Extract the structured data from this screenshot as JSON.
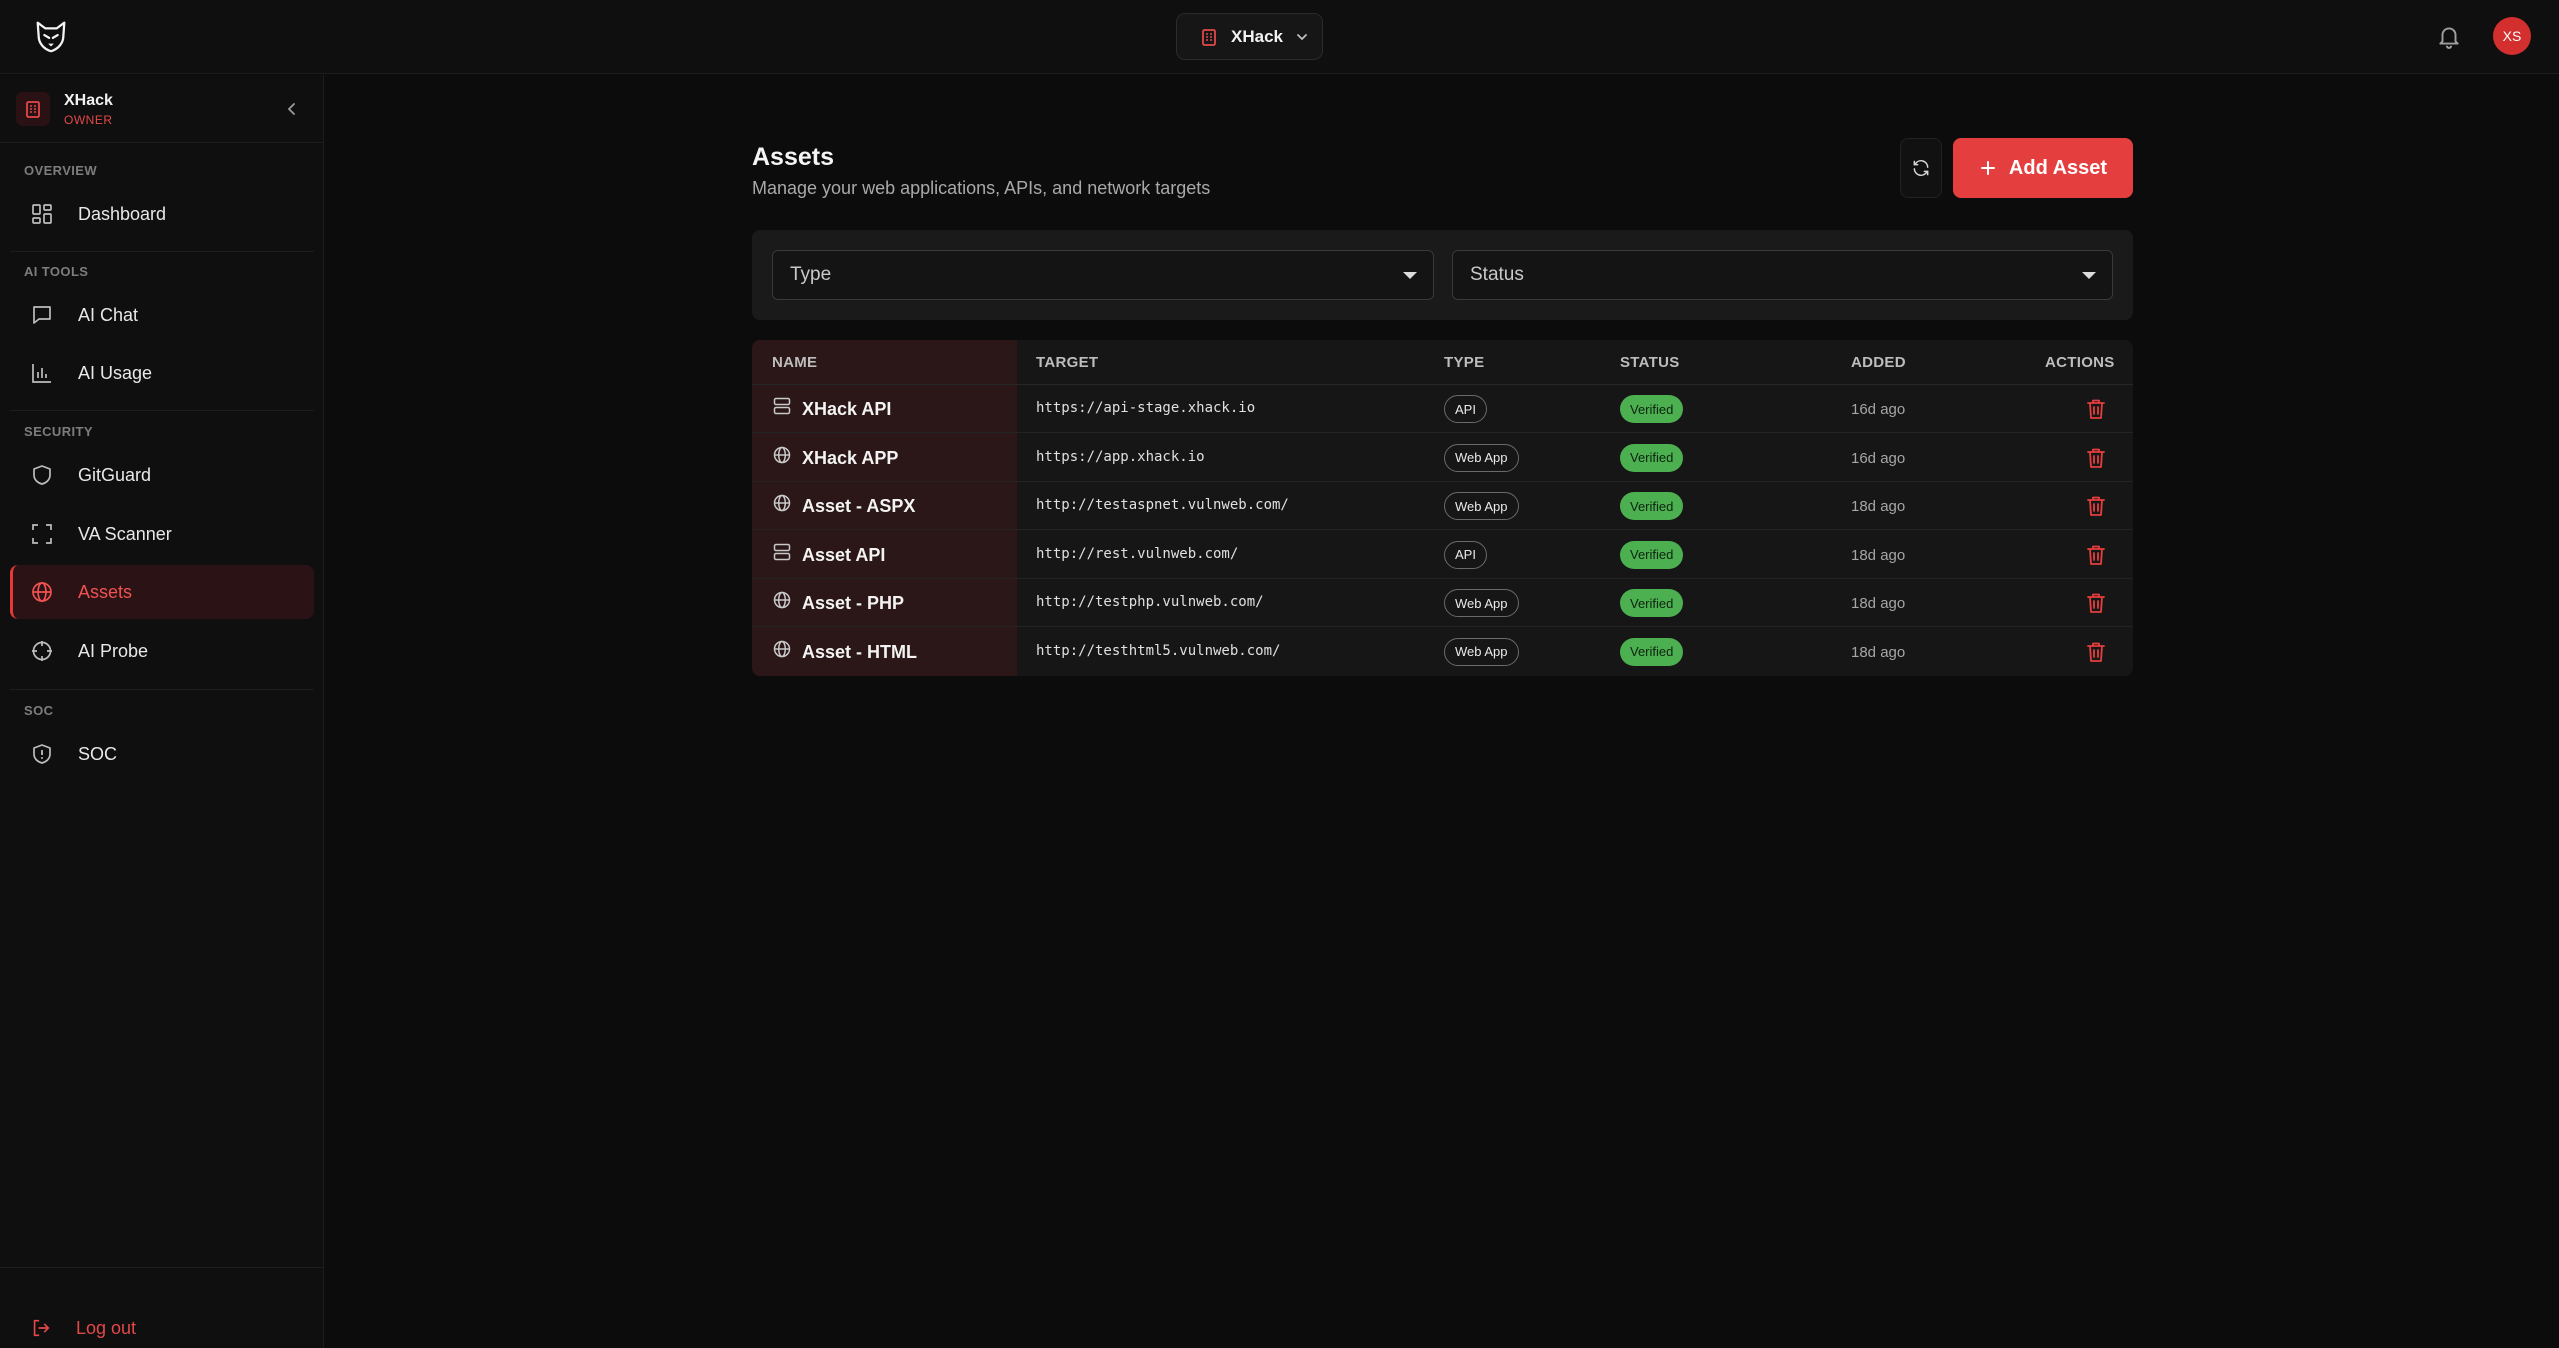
{
  "header": {
    "org_name": "XHack",
    "avatar_initials": "XS"
  },
  "sidebar": {
    "workspace": {
      "name": "XHack",
      "role": "OWNER"
    },
    "sections": [
      {
        "title": "OVERVIEW",
        "items": [
          {
            "label": "Dashboard",
            "icon": "dashboard-icon"
          }
        ]
      },
      {
        "title": "AI TOOLS",
        "items": [
          {
            "label": "AI Chat",
            "icon": "chat-icon"
          },
          {
            "label": "AI Usage",
            "icon": "bar-chart-icon"
          }
        ]
      },
      {
        "title": "SECURITY",
        "items": [
          {
            "label": "GitGuard",
            "icon": "shield-icon"
          },
          {
            "label": "VA Scanner",
            "icon": "scan-icon"
          },
          {
            "label": "Assets",
            "icon": "globe-icon",
            "active": true
          },
          {
            "label": "AI Probe",
            "icon": "crosshair-icon"
          }
        ]
      },
      {
        "title": "SOC",
        "items": [
          {
            "label": "SOC",
            "icon": "shield-alert-icon"
          }
        ]
      }
    ],
    "logout_label": "Log out"
  },
  "main": {
    "title": "Assets",
    "subtitle": "Manage your web applications, APIs, and network targets",
    "add_button_label": "Add Asset",
    "filters": {
      "type_placeholder": "Type",
      "status_placeholder": "Status"
    },
    "columns": {
      "name": "NAME",
      "target": "TARGET",
      "type": "TYPE",
      "status": "STATUS",
      "added": "ADDED",
      "actions": "ACTIONS"
    },
    "rows": [
      {
        "name": "XHack API",
        "icon": "server-icon",
        "target": "https://api-stage.xhack.io",
        "type": "API",
        "status": "Verified",
        "added": "16d ago"
      },
      {
        "name": "XHack APP",
        "icon": "globe-icon",
        "target": "https://app.xhack.io",
        "type": "Web App",
        "status": "Verified",
        "added": "16d ago"
      },
      {
        "name": "Asset - ASPX",
        "icon": "globe-icon",
        "target": "http://testaspnet.vulnweb.com/",
        "type": "Web App",
        "status": "Verified",
        "added": "18d ago"
      },
      {
        "name": "Asset API",
        "icon": "server-icon",
        "target": "http://rest.vulnweb.com/",
        "type": "API",
        "status": "Verified",
        "added": "18d ago"
      },
      {
        "name": "Asset - PHP",
        "icon": "globe-icon",
        "target": "http://testphp.vulnweb.com/",
        "type": "Web App",
        "status": "Verified",
        "added": "18d ago"
      },
      {
        "name": "Asset - HTML",
        "icon": "globe-icon",
        "target": "http://testhtml5.vulnweb.com/",
        "type": "Web App",
        "status": "Verified",
        "added": "18d ago"
      }
    ]
  },
  "colors": {
    "accent": "#e53e3e",
    "verified": "#4caf50",
    "background": "#0c0c0c"
  }
}
